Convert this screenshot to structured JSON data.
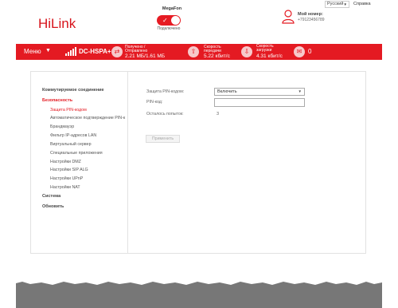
{
  "header": {
    "logo": "HiLink",
    "operator": "MegaFon",
    "connection_status": "Подключено",
    "my_number_label": "Мой номер:",
    "my_number": "+79123456789",
    "language": "Русский",
    "help": "Справка"
  },
  "bar": {
    "menu_label": "Меню",
    "network_type": "DC-HSPA+",
    "received_sent_label": "Получено / Отправлено",
    "received_sent_value": "2.21 МБ/1.61 МБ",
    "upload_speed_label": "Скорость передачи",
    "upload_speed_value": "5.22 кбит/с",
    "download_speed_label": "Скорость загрузки",
    "download_speed_value": "4.31 кбит/с",
    "messages_count": "0",
    "signal_bars": 5
  },
  "sidebar": {
    "switched_connection": "Коммутируемое соединение",
    "security": "Безопасность",
    "security_items": [
      "Защита PIN-кодом",
      "Автоматическое подтверждение PIN-к",
      "Брандмауэр",
      "Фильтр IP-адресов LAN",
      "Виртуальный сервер",
      "Специальные приложения",
      "Настройки DMZ",
      "Настройки SIP ALG",
      "Настройки UPnP",
      "Настройки NAT"
    ],
    "system": "Система",
    "update": "Обновить"
  },
  "form": {
    "pin_protection_label": "Защита PIN-кодом:",
    "pin_protection_value": "Включить",
    "pin_label": "PIN-код:",
    "pin_value": "",
    "tries_label": "Осталось попыток:",
    "tries_value": "3",
    "apply_button": "Применить"
  },
  "colors": {
    "brand_red": "#e41a22",
    "footer_gray": "#777777"
  }
}
